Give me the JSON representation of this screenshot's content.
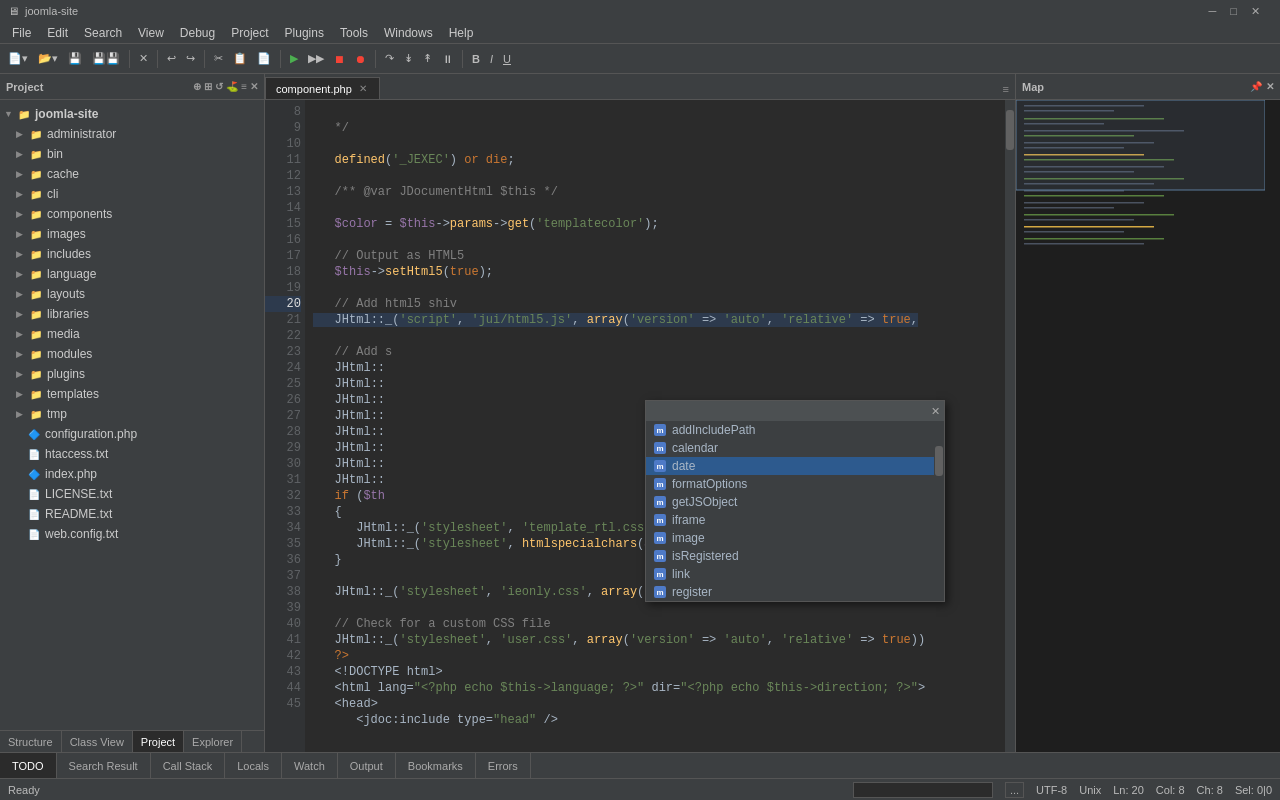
{
  "titleBar": {
    "title": "joomla-site"
  },
  "menuBar": {
    "items": [
      "File",
      "Edit",
      "Search",
      "View",
      "Debug",
      "Project",
      "Plugins",
      "Tools",
      "Windows",
      "Help"
    ]
  },
  "project": {
    "header": "Project",
    "tree": {
      "rootName": "joomla-site",
      "items": [
        {
          "label": "administrator",
          "type": "folder",
          "level": 1,
          "expanded": false
        },
        {
          "label": "bin",
          "type": "folder",
          "level": 1,
          "expanded": false
        },
        {
          "label": "cache",
          "type": "folder",
          "level": 1,
          "expanded": false
        },
        {
          "label": "cli",
          "type": "folder",
          "level": 1,
          "expanded": false
        },
        {
          "label": "components",
          "type": "folder",
          "level": 1,
          "expanded": false
        },
        {
          "label": "images",
          "type": "folder",
          "level": 1,
          "expanded": false
        },
        {
          "label": "includes",
          "type": "folder",
          "level": 1,
          "expanded": false
        },
        {
          "label": "language",
          "type": "folder",
          "level": 1,
          "expanded": false
        },
        {
          "label": "layouts",
          "type": "folder",
          "level": 1,
          "expanded": false
        },
        {
          "label": "libraries",
          "type": "folder",
          "level": 1,
          "expanded": false
        },
        {
          "label": "media",
          "type": "folder",
          "level": 1,
          "expanded": false
        },
        {
          "label": "modules",
          "type": "folder",
          "level": 1,
          "expanded": false
        },
        {
          "label": "plugins",
          "type": "folder",
          "level": 1,
          "expanded": false
        },
        {
          "label": "templates",
          "type": "folder",
          "level": 1,
          "expanded": false
        },
        {
          "label": "tmp",
          "type": "folder",
          "level": 1,
          "expanded": false
        },
        {
          "label": "configuration.php",
          "type": "php",
          "level": 1
        },
        {
          "label": "htaccess.txt",
          "type": "txt",
          "level": 1
        },
        {
          "label": "index.php",
          "type": "php",
          "level": 1
        },
        {
          "label": "LICENSE.txt",
          "type": "txt",
          "level": 1
        },
        {
          "label": "README.txt",
          "type": "txt",
          "level": 1
        },
        {
          "label": "web.config.txt",
          "type": "txt",
          "level": 1
        }
      ]
    }
  },
  "leftTabs": [
    "Structure",
    "Class View",
    "Project",
    "Explorer"
  ],
  "editor": {
    "activeTab": "component.php",
    "lines": [
      {
        "num": 8,
        "text": "   */"
      },
      {
        "num": 9,
        "text": ""
      },
      {
        "num": 10,
        "text": "   defined('_JEXEC') or die;"
      },
      {
        "num": 11,
        "text": ""
      },
      {
        "num": 12,
        "text": "   /** @var JDocumentHtml $this */"
      },
      {
        "num": 13,
        "text": ""
      },
      {
        "num": 14,
        "text": "   $color = $this->params->get('templatecolor');"
      },
      {
        "num": 15,
        "text": ""
      },
      {
        "num": 16,
        "text": "   // Output as HTML5"
      },
      {
        "num": 17,
        "text": "   $this->setHtml5(true);"
      },
      {
        "num": 18,
        "text": ""
      },
      {
        "num": 19,
        "text": "   // Add html5 shiv"
      },
      {
        "num": 20,
        "text": "   JHtml::_('script', 'jui/html5.js', array('version' => 'auto', 'relative' => true,"
      },
      {
        "num": 21,
        "text": ""
      },
      {
        "num": 22,
        "text": "   // Add s"
      },
      {
        "num": 23,
        "text": "   JHtml::"
      },
      {
        "num": 24,
        "text": "   JHtml::"
      },
      {
        "num": 25,
        "text": "   JHtml::"
      },
      {
        "num": 26,
        "text": "   JHtml::"
      },
      {
        "num": 27,
        "text": "   JHtml::"
      },
      {
        "num": 28,
        "text": "   JHtml::"
      },
      {
        "num": 29,
        "text": "   JHtml::"
      },
      {
        "num": 30,
        "text": "   JHtml::"
      },
      {
        "num": 31,
        "text": "   if ($th"
      },
      {
        "num": 32,
        "text": "   {"
      },
      {
        "num": 33,
        "text": "      JHtml::_('stylesheet', 'template_rtl.css', array('version' => 'auto', 'relativ"
      },
      {
        "num": 34,
        "text": "      JHtml::_('stylesheet', htmlspecialchars($color, ENT_COMPAT, 'UTF-8') . '_rtl.c"
      },
      {
        "num": 35,
        "text": "   }"
      },
      {
        "num": 36,
        "text": ""
      },
      {
        "num": 37,
        "text": "   JHtml::_('stylesheet', 'ieonly.css', array('version' => 'auto', 'relative' => true"
      },
      {
        "num": 38,
        "text": ""
      },
      {
        "num": 39,
        "text": "   // Check for a custom CSS file"
      },
      {
        "num": 40,
        "text": "   JHtml::_('stylesheet', 'user.css', array('version' => 'auto', 'relative' => true))"
      },
      {
        "num": 41,
        "text": "   ?>"
      },
      {
        "num": 42,
        "text": "   <!DOCTYPE html>"
      },
      {
        "num": 43,
        "text": "   <html lang=\"<?php echo $this->language; ?>\" dir=\"<?php echo $this->direction; ?>\">"
      },
      {
        "num": 44,
        "text": "   <head>"
      },
      {
        "num": 45,
        "text": "      <jdoc:include type=\"head\" />"
      }
    ]
  },
  "autocomplete": {
    "items": [
      {
        "label": "addIncludePath",
        "type": "method"
      },
      {
        "label": "calendar",
        "type": "method"
      },
      {
        "label": "date",
        "type": "method"
      },
      {
        "label": "formatOptions",
        "type": "method"
      },
      {
        "label": "getJSObject",
        "type": "method"
      },
      {
        "label": "iframe",
        "type": "method"
      },
      {
        "label": "image",
        "type": "method"
      },
      {
        "label": "isRegistered",
        "type": "method"
      },
      {
        "label": "link",
        "type": "method"
      },
      {
        "label": "register",
        "type": "method"
      }
    ]
  },
  "mapPanel": {
    "header": "Map"
  },
  "bottomTabs": [
    "TODO",
    "Search Result",
    "Call Stack",
    "Locals",
    "Watch",
    "Output",
    "Bookmarks",
    "Errors"
  ],
  "statusBar": {
    "status": "Ready",
    "encoding": "UTF-8",
    "lineEnding": "Unix",
    "ln": "Ln: 20",
    "col": "Col: 8",
    "ch": "Ch: 8",
    "sel": "Sel: 0|0"
  }
}
